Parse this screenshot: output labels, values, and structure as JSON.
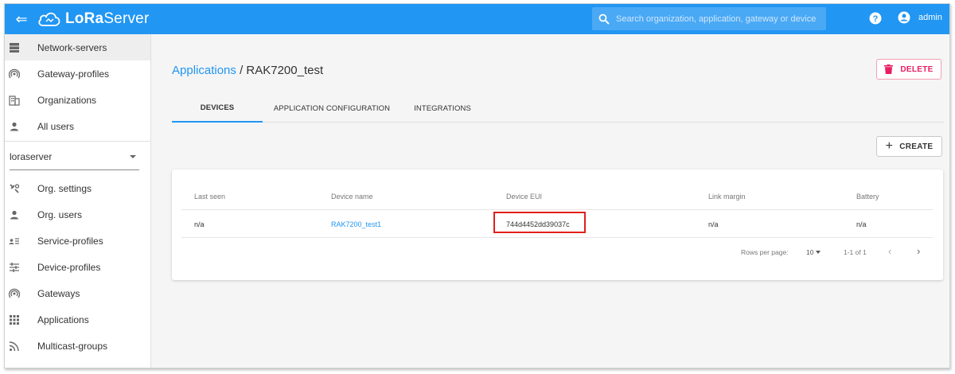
{
  "appbar": {
    "logo_prefix": "LoRa",
    "logo_suffix": "Server",
    "search_placeholder": "Search organization, application, gateway or device",
    "username": "admin",
    "color": "#2196f3"
  },
  "sidebar": {
    "top_items": [
      {
        "label": "Network-servers",
        "icon": "server-icon",
        "active": true
      },
      {
        "label": "Gateway-profiles",
        "icon": "broadcast-icon"
      },
      {
        "label": "Organizations",
        "icon": "building-icon"
      },
      {
        "label": "All users",
        "icon": "person-icon"
      }
    ],
    "org_selected": "loraserver",
    "org_items": [
      {
        "label": "Org. settings",
        "icon": "settings-icon"
      },
      {
        "label": "Org. users",
        "icon": "person-icon"
      },
      {
        "label": "Service-profiles",
        "icon": "account-list-icon"
      },
      {
        "label": "Device-profiles",
        "icon": "tune-icon"
      },
      {
        "label": "Gateways",
        "icon": "broadcast-icon"
      },
      {
        "label": "Applications",
        "icon": "apps-grid-icon"
      },
      {
        "label": "Multicast-groups",
        "icon": "rss-icon"
      }
    ]
  },
  "breadcrumb": {
    "link": "Applications",
    "separator": "/",
    "current": "RAK7200_test"
  },
  "actions": {
    "delete_label": "DELETE",
    "create_label": "CREATE"
  },
  "tabs": [
    {
      "label": "DEVICES",
      "active": true
    },
    {
      "label": "APPLICATION CONFIGURATION"
    },
    {
      "label": "INTEGRATIONS"
    }
  ],
  "table": {
    "headers": [
      "Last seen",
      "Device name",
      "Device EUI",
      "Link margin",
      "Battery"
    ],
    "rows": [
      {
        "last_seen": "n/a",
        "device_name": "RAK7200_test1",
        "device_eui": "744d4452dd39037c",
        "link_margin": "n/a",
        "battery": "n/a"
      }
    ],
    "pagination": {
      "rows_per_page_label": "Rows per page:",
      "rows_per_page": "10",
      "range": "1-1 of 1"
    }
  },
  "highlight_color": "#e0201b"
}
